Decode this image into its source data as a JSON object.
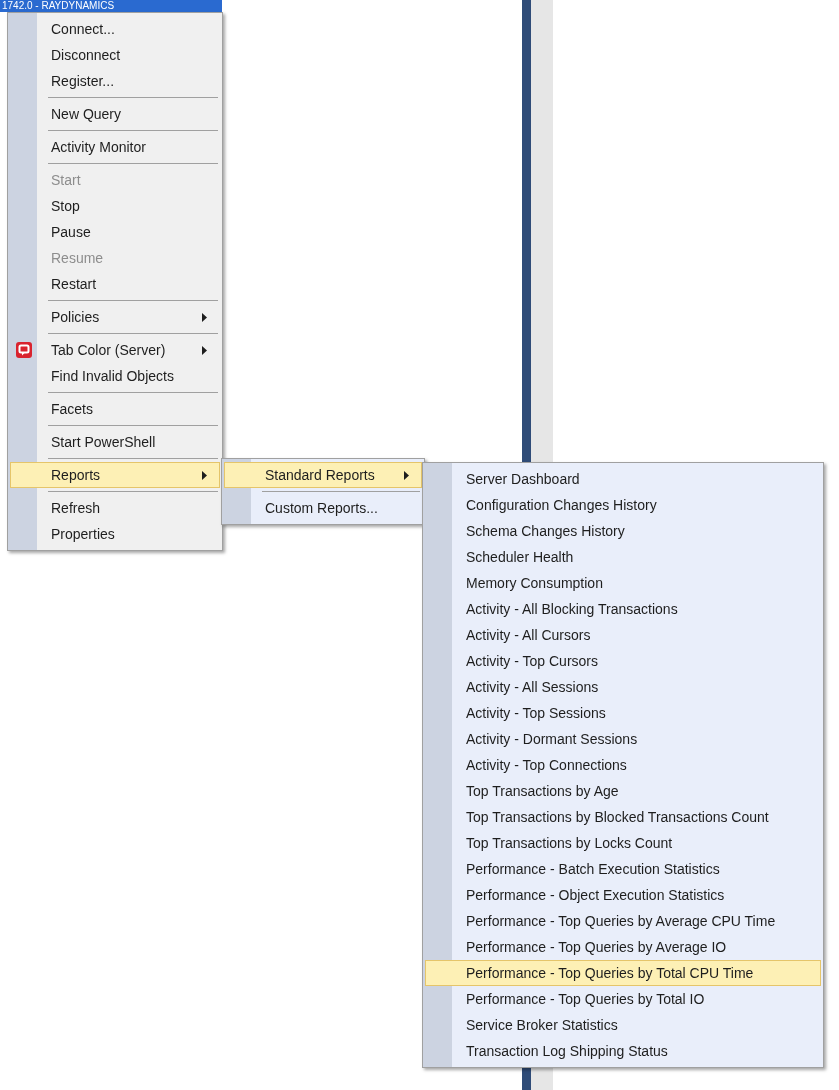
{
  "tree_node": {
    "text": "1742.0 - RAYDYNAMICS",
    "selected": true
  },
  "context_menu": {
    "groups": [
      [
        {
          "label": "Connect...",
          "disabled": false,
          "submenu": false,
          "selected": false,
          "icon": false
        },
        {
          "label": "Disconnect",
          "disabled": false,
          "submenu": false,
          "selected": false,
          "icon": false
        },
        {
          "label": "Register...",
          "disabled": false,
          "submenu": false,
          "selected": false,
          "icon": false
        }
      ],
      [
        {
          "label": "New Query",
          "disabled": false,
          "submenu": false,
          "selected": false,
          "icon": false
        }
      ],
      [
        {
          "label": "Activity Monitor",
          "disabled": false,
          "submenu": false,
          "selected": false,
          "icon": false
        }
      ],
      [
        {
          "label": "Start",
          "disabled": true,
          "submenu": false,
          "selected": false,
          "icon": false
        },
        {
          "label": "Stop",
          "disabled": false,
          "submenu": false,
          "selected": false,
          "icon": false
        },
        {
          "label": "Pause",
          "disabled": false,
          "submenu": false,
          "selected": false,
          "icon": false
        },
        {
          "label": "Resume",
          "disabled": true,
          "submenu": false,
          "selected": false,
          "icon": false
        },
        {
          "label": "Restart",
          "disabled": false,
          "submenu": false,
          "selected": false,
          "icon": false
        }
      ],
      [
        {
          "label": "Policies",
          "disabled": false,
          "submenu": true,
          "selected": false,
          "icon": false
        }
      ],
      [
        {
          "label": "Tab Color (Server)",
          "disabled": false,
          "submenu": true,
          "selected": false,
          "icon": true
        },
        {
          "label": "Find Invalid Objects",
          "disabled": false,
          "submenu": false,
          "selected": false,
          "icon": false
        }
      ],
      [
        {
          "label": "Facets",
          "disabled": false,
          "submenu": false,
          "selected": false,
          "icon": false
        }
      ],
      [
        {
          "label": "Start PowerShell",
          "disabled": false,
          "submenu": false,
          "selected": false,
          "icon": false
        }
      ],
      [
        {
          "label": "Reports",
          "disabled": false,
          "submenu": true,
          "selected": true,
          "icon": false
        }
      ],
      [
        {
          "label": "Refresh",
          "disabled": false,
          "submenu": false,
          "selected": false,
          "icon": false
        },
        {
          "label": "Properties",
          "disabled": false,
          "submenu": false,
          "selected": false,
          "icon": false
        }
      ]
    ]
  },
  "reports_submenu": {
    "groups": [
      [
        {
          "label": "Standard Reports",
          "disabled": false,
          "submenu": true,
          "selected": true,
          "icon": false
        }
      ],
      [
        {
          "label": "Custom Reports...",
          "disabled": false,
          "submenu": false,
          "selected": false,
          "icon": false
        }
      ]
    ]
  },
  "standard_reports_submenu": {
    "groups": [
      [
        {
          "label": "Server Dashboard",
          "disabled": false,
          "submenu": false,
          "selected": false,
          "icon": false
        },
        {
          "label": "Configuration Changes History",
          "disabled": false,
          "submenu": false,
          "selected": false,
          "icon": false
        },
        {
          "label": "Schema Changes History",
          "disabled": false,
          "submenu": false,
          "selected": false,
          "icon": false
        },
        {
          "label": "Scheduler Health",
          "disabled": false,
          "submenu": false,
          "selected": false,
          "icon": false
        },
        {
          "label": "Memory Consumption",
          "disabled": false,
          "submenu": false,
          "selected": false,
          "icon": false
        },
        {
          "label": "Activity - All Blocking Transactions",
          "disabled": false,
          "submenu": false,
          "selected": false,
          "icon": false
        },
        {
          "label": "Activity - All Cursors",
          "disabled": false,
          "submenu": false,
          "selected": false,
          "icon": false
        },
        {
          "label": "Activity - Top Cursors",
          "disabled": false,
          "submenu": false,
          "selected": false,
          "icon": false
        },
        {
          "label": "Activity - All Sessions",
          "disabled": false,
          "submenu": false,
          "selected": false,
          "icon": false
        },
        {
          "label": "Activity - Top Sessions",
          "disabled": false,
          "submenu": false,
          "selected": false,
          "icon": false
        },
        {
          "label": "Activity - Dormant Sessions",
          "disabled": false,
          "submenu": false,
          "selected": false,
          "icon": false
        },
        {
          "label": "Activity - Top Connections",
          "disabled": false,
          "submenu": false,
          "selected": false,
          "icon": false
        },
        {
          "label": "Top Transactions by Age",
          "disabled": false,
          "submenu": false,
          "selected": false,
          "icon": false
        },
        {
          "label": "Top Transactions by Blocked Transactions Count",
          "disabled": false,
          "submenu": false,
          "selected": false,
          "icon": false
        },
        {
          "label": "Top Transactions by Locks Count",
          "disabled": false,
          "submenu": false,
          "selected": false,
          "icon": false
        },
        {
          "label": "Performance - Batch Execution Statistics",
          "disabled": false,
          "submenu": false,
          "selected": false,
          "icon": false
        },
        {
          "label": "Performance - Object Execution Statistics",
          "disabled": false,
          "submenu": false,
          "selected": false,
          "icon": false
        },
        {
          "label": "Performance - Top Queries by Average CPU Time",
          "disabled": false,
          "submenu": false,
          "selected": false,
          "icon": false
        },
        {
          "label": "Performance - Top Queries by Average IO",
          "disabled": false,
          "submenu": false,
          "selected": false,
          "icon": false
        },
        {
          "label": "Performance - Top Queries by Total CPU Time",
          "disabled": false,
          "submenu": false,
          "selected": true,
          "icon": false
        },
        {
          "label": "Performance - Top Queries by Total IO",
          "disabled": false,
          "submenu": false,
          "selected": false,
          "icon": false
        },
        {
          "label": "Service Broker Statistics",
          "disabled": false,
          "submenu": false,
          "selected": false,
          "icon": false
        },
        {
          "label": "Transaction Log Shipping Status",
          "disabled": false,
          "submenu": false,
          "selected": false,
          "icon": false
        }
      ]
    ]
  }
}
